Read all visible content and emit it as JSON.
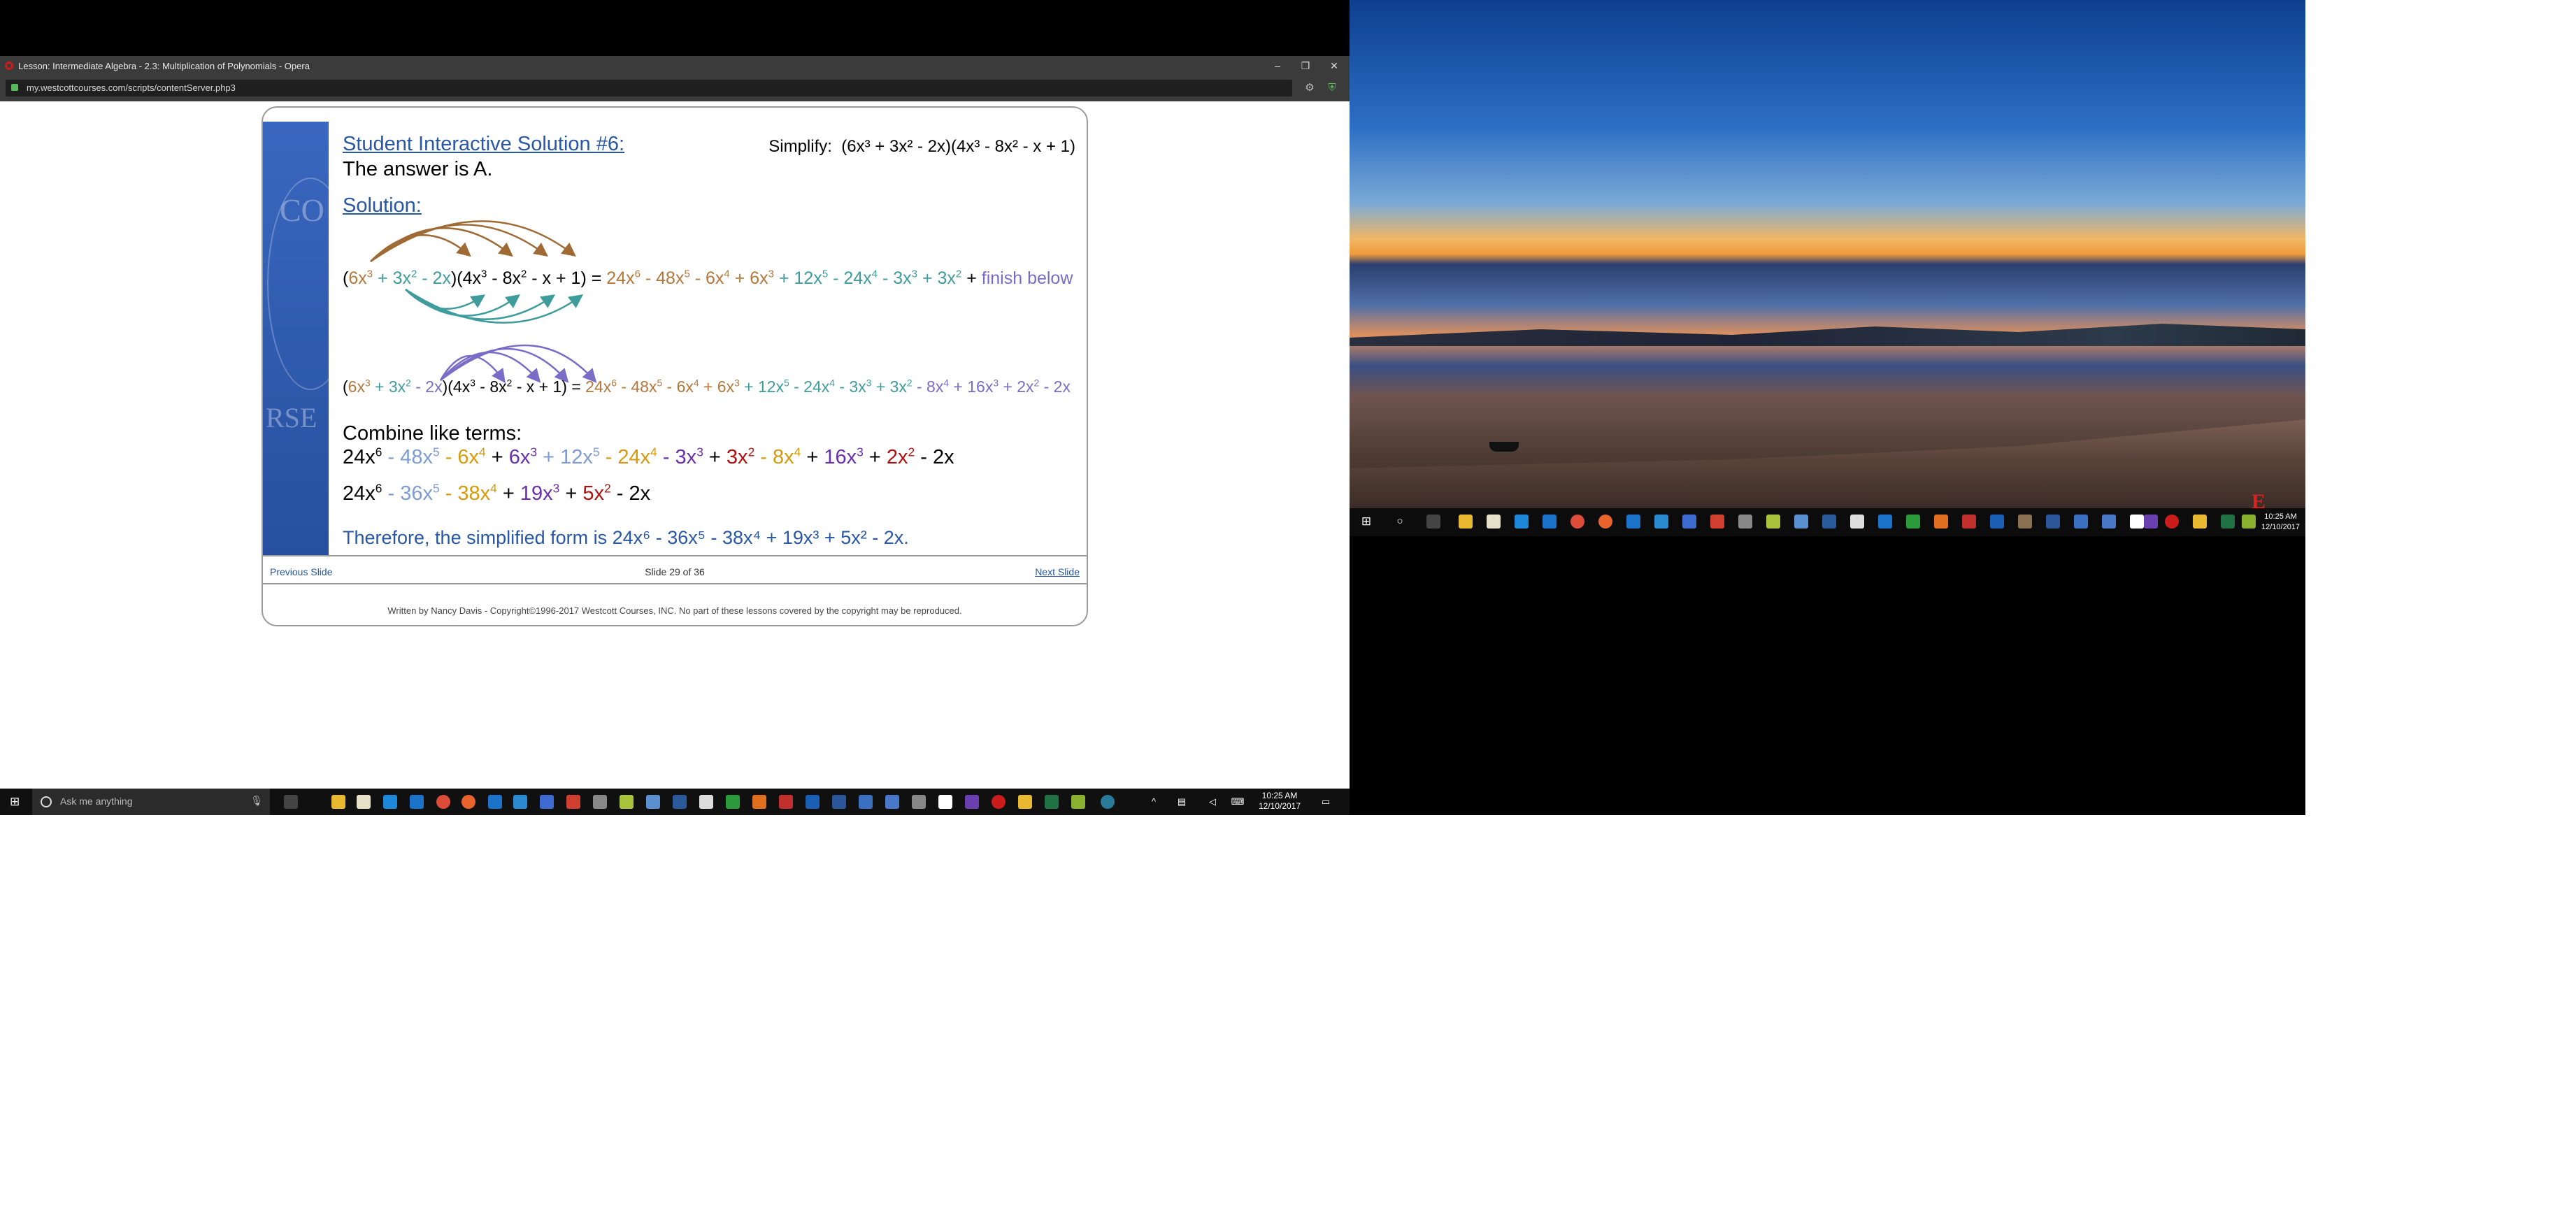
{
  "browser": {
    "window_title": "Lesson: Intermediate Algebra - 2.3: Multiplication of Polynomials - Opera",
    "url": "my.westcottcourses.com/scripts/contentServer.php3",
    "minimize": "–",
    "restore": "❐",
    "close": "✕"
  },
  "lesson": {
    "solution_title": "Student Interactive Solution #6:",
    "answer": "The answer is A.",
    "simplify_label": "Simplify:",
    "problem": "(6x³ + 3x² - 2x)(4x³ - 8x² - x + 1)",
    "solution_label": "Solution:",
    "line1_suffix": "finish below",
    "combine_label": "Combine like terms:",
    "therefore": "Therefore, the simplified form is 24x⁶ - 36x⁵ - 38x⁴ + 19x³ + 5x² - 2x.",
    "prev_slide": "Previous Slide",
    "slide_counter": "Slide 29 of 36",
    "next_slide": "Next Slide",
    "copyright": "Written by Nancy Davis - Copyright©1996-2017 Westcott Courses, INC. No part of these lessons covered by the copyright may be reproduced.",
    "seal_letters": "CO  RSE  SCIENTIA"
  },
  "taskbar_left": {
    "search_placeholder": "Ask me anything",
    "time": "10:25 AM",
    "date": "12/10/2017"
  },
  "taskbar_right": {
    "time": "10:25 AM",
    "date": "12/10/2017"
  },
  "colors": {
    "link_blue": "#2757a6",
    "sidebar_blue": "#2f5bb0",
    "term_brown": "#b5773a",
    "term_teal": "#3f9c9c",
    "term_purple": "#7b6cc7"
  }
}
